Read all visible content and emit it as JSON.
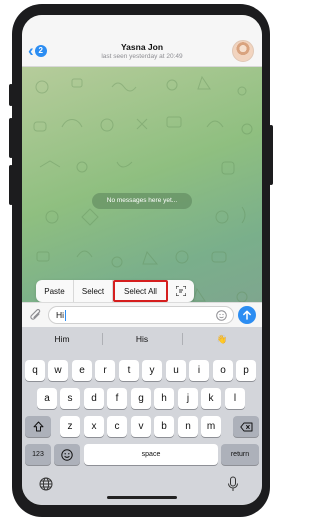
{
  "header": {
    "back_badge": "2",
    "title": "Yasna Jon",
    "status": "last seen yesterday at 20:49"
  },
  "chat": {
    "empty_text": "No messages here yet..."
  },
  "edit_menu": {
    "paste": "Paste",
    "select": "Select",
    "select_all": "Select All"
  },
  "input": {
    "value": "Hi"
  },
  "keyboard": {
    "suggestions": [
      "Him",
      "His",
      "👋"
    ],
    "row1": [
      "q",
      "w",
      "e",
      "r",
      "t",
      "y",
      "u",
      "i",
      "o",
      "p"
    ],
    "row2": [
      "a",
      "s",
      "d",
      "f",
      "g",
      "h",
      "j",
      "k",
      "l"
    ],
    "row3": [
      "z",
      "x",
      "c",
      "v",
      "b",
      "n",
      "m"
    ],
    "numbers_label": "123",
    "space_label": "space",
    "return_label": "return"
  },
  "colors": {
    "accent": "#2c8df2",
    "highlight": "#d51e1e"
  }
}
